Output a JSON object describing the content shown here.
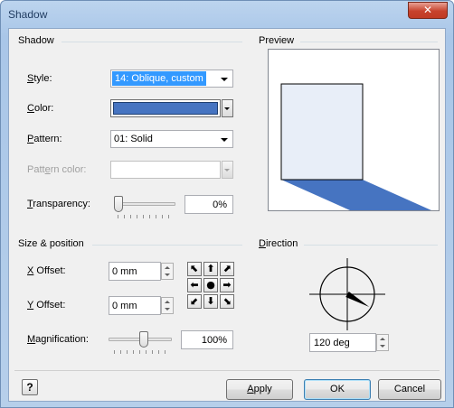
{
  "window": {
    "title": "Shadow",
    "close_glyph": "✕"
  },
  "shadow_group": {
    "title": "Shadow",
    "style": {
      "label_pre": "",
      "label_ul": "S",
      "label_post": "tyle:",
      "value": "14: Oblique, custom"
    },
    "color": {
      "label_pre": "",
      "label_ul": "C",
      "label_post": "olor:",
      "value_hex": "#4674c1"
    },
    "pattern": {
      "label_pre": "",
      "label_ul": "P",
      "label_post": "attern:",
      "value": "01: Solid"
    },
    "pattern_color": {
      "label_pre": "Patt",
      "label_ul": "e",
      "label_post": "rn color:"
    },
    "transparency": {
      "label_pre": "",
      "label_ul": "T",
      "label_post": "ransparency:",
      "value": "0%",
      "level_percent": 0
    }
  },
  "preview_group": {
    "title": "Preview"
  },
  "size_position_group": {
    "title": "Size & position",
    "x_offset": {
      "label_pre": "",
      "label_ul": "X",
      "label_post": " Offset:",
      "value": "0 mm"
    },
    "y_offset": {
      "label_pre": "",
      "label_ul": "Y",
      "label_post": " Offset:",
      "value": "0 mm"
    },
    "magnification": {
      "label_pre": "",
      "label_ul": "M",
      "label_post": "agnification:",
      "value": "100%",
      "level_percent": 100
    },
    "direction_buttons": [
      {
        "name": "nudge-up-left-button",
        "glyph": "⬉"
      },
      {
        "name": "nudge-up-button",
        "glyph": "⬆"
      },
      {
        "name": "nudge-up-right-button",
        "glyph": "⬈"
      },
      {
        "name": "nudge-left-button",
        "glyph": "⬅"
      },
      {
        "name": "nudge-center-button",
        "glyph": "●"
      },
      {
        "name": "nudge-right-button",
        "glyph": "➡"
      },
      {
        "name": "nudge-down-left-button",
        "glyph": "⬋"
      },
      {
        "name": "nudge-down-button",
        "glyph": "⬇"
      },
      {
        "name": "nudge-down-right-button",
        "glyph": "⬊"
      }
    ]
  },
  "direction_group": {
    "title_pre": "",
    "title_ul": "D",
    "title_post": "irection",
    "angle_value": "120 deg",
    "angle_degrees": 120
  },
  "footer": {
    "help_glyph": "?",
    "apply_pre": "",
    "apply_ul": "A",
    "apply_post": "pply",
    "ok_label": "OK",
    "cancel_label": "Cancel"
  },
  "colors": {
    "accent_blue": "#4674c1",
    "selection": "#3399ff",
    "preview_square_fill": "#e8eef8"
  }
}
